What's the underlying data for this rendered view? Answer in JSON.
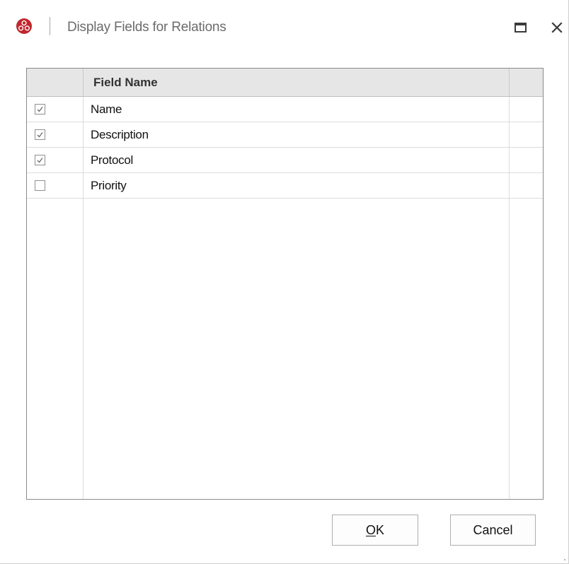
{
  "window": {
    "title": "Display Fields for Relations",
    "app_icon": "app-logo-icon",
    "controls": {
      "maximize_icon": "maximize-icon",
      "close_icon": "close-icon"
    }
  },
  "grid": {
    "columns": [
      "",
      "Field Name",
      ""
    ],
    "rows": [
      {
        "checked": true,
        "field_name": "Name"
      },
      {
        "checked": true,
        "field_name": "Description"
      },
      {
        "checked": true,
        "field_name": "Protocol"
      },
      {
        "checked": false,
        "field_name": "Priority"
      }
    ]
  },
  "buttons": {
    "ok_mnemonic": "O",
    "ok_rest": "K",
    "cancel_label": "Cancel"
  },
  "colors": {
    "app_icon": "#c0272d",
    "header_background": "#e6e6e6",
    "title_text": "#6b6b6b"
  }
}
